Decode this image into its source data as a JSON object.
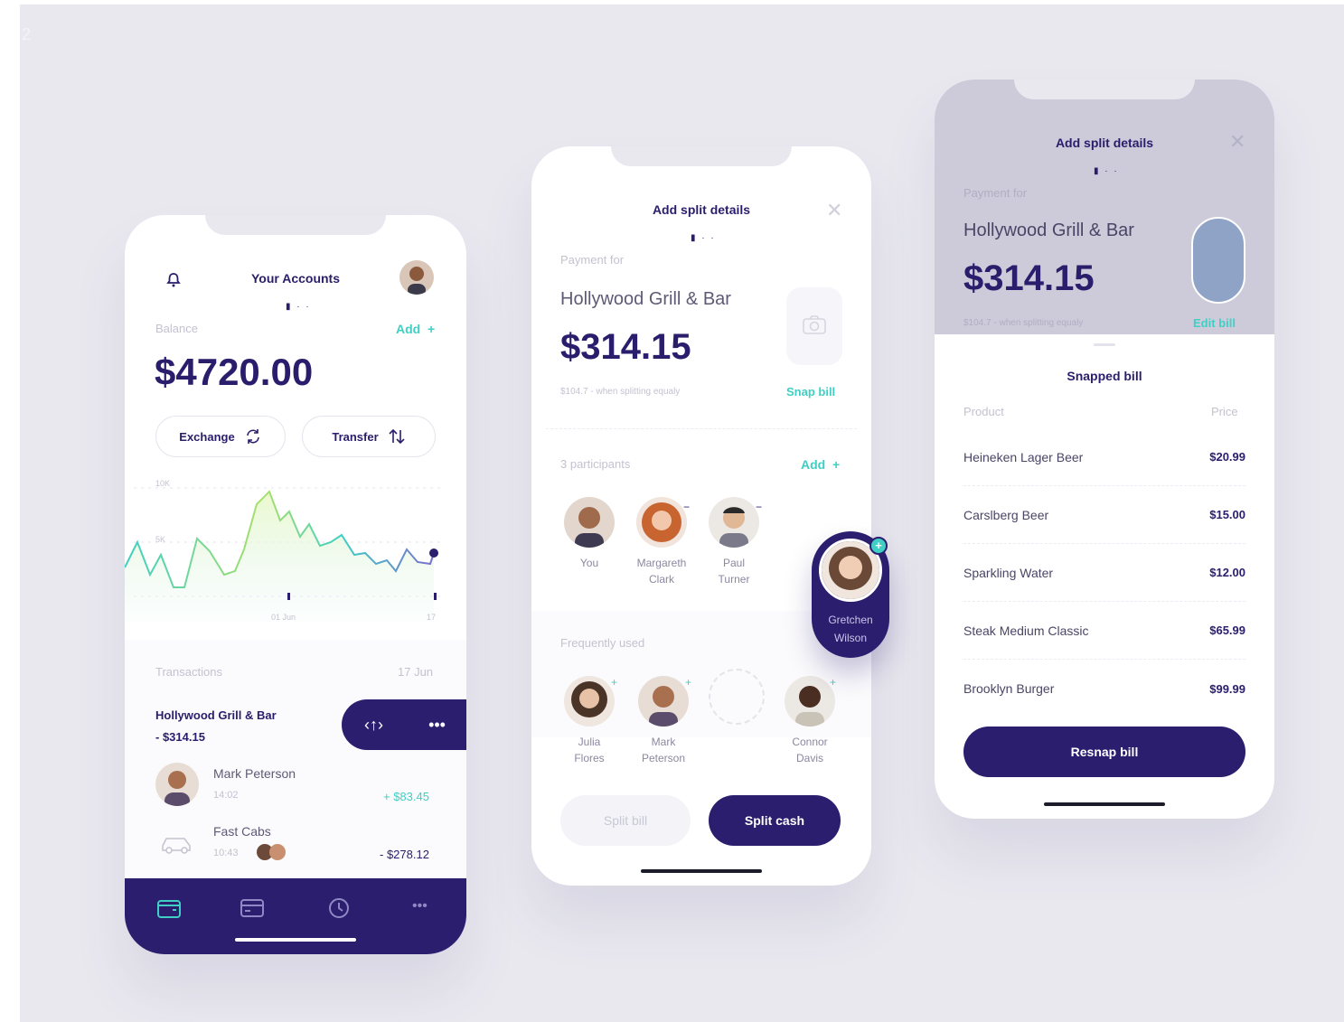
{
  "slide_number": "2",
  "colors": {
    "accent": "#2b1e6f",
    "teal": "#3fcfc4",
    "background": "#e9e8ef",
    "muted": "#c3c2d0"
  },
  "accounts": {
    "title": "Your Accounts",
    "balance_label": "Balance",
    "add_label": "Add",
    "balance": "$4720.00",
    "exchange_label": "Exchange",
    "transfer_label": "Transfer",
    "chart_y_10k": "10K",
    "chart_y_5k": "5K",
    "chart_x_start": "01 Jun",
    "chart_x_end": "17",
    "transactions_label": "Transactions",
    "transactions_date": "17 Jun",
    "transactions": [
      {
        "title": "Hollywood Grill & Bar",
        "amount": "- $314.15"
      },
      {
        "title": "Mark Peterson",
        "time": "14:02",
        "amount": "+ $83.45"
      },
      {
        "title": "Fast Cabs",
        "time": "10:43",
        "amount": "- $278.12"
      }
    ],
    "swipe_icon": "split-icon",
    "nav_icons": [
      "wallet-icon",
      "card-icon",
      "history-icon",
      "more-icon"
    ]
  },
  "split": {
    "title": "Add split details",
    "payment_for_label": "Payment for",
    "merchant": "Hollywood Grill & Bar",
    "amount": "$314.15",
    "split_note": "$104.7 - when splitting equaly",
    "snap_bill": "Snap bill",
    "participants_label": "3 participants",
    "add_label": "Add",
    "participants": [
      {
        "name_1": "You",
        "name_2": ""
      },
      {
        "name_1": "Margareth",
        "name_2": "Clark"
      },
      {
        "name_1": "Paul",
        "name_2": "Turner"
      }
    ],
    "frequently_used_label": "Frequently used",
    "frequent": [
      {
        "name_1": "Julia",
        "name_2": "Flores"
      },
      {
        "name_1": "Mark",
        "name_2": "Peterson"
      },
      {
        "name_1": "Connor",
        "name_2": "Davis"
      }
    ],
    "split_bill_button": "Split bill",
    "split_cash_button": "Split cash"
  },
  "bubble": {
    "name_1": "Gretchen",
    "name_2": "Wilson"
  },
  "snapped": {
    "title": "Add split details",
    "payment_for_label": "Payment for",
    "merchant": "Hollywood Grill & Bar",
    "amount": "$314.15",
    "split_note": "$104.7 - when splitting equaly",
    "edit_bill": "Edit bill",
    "sheet_title": "Snapped bill",
    "col_product": "Product",
    "col_price": "Price",
    "items": [
      {
        "product": "Heineken Lager Beer",
        "price": "$20.99"
      },
      {
        "product": "Carslberg Beer",
        "price": "$15.00"
      },
      {
        "product": "Sparkling Water",
        "price": "$12.00"
      },
      {
        "product": "Steak Medium Classic",
        "price": "$65.99"
      },
      {
        "product": "Brooklyn Burger",
        "price": "$99.99"
      }
    ],
    "resnap_button": "Resnap bill"
  }
}
